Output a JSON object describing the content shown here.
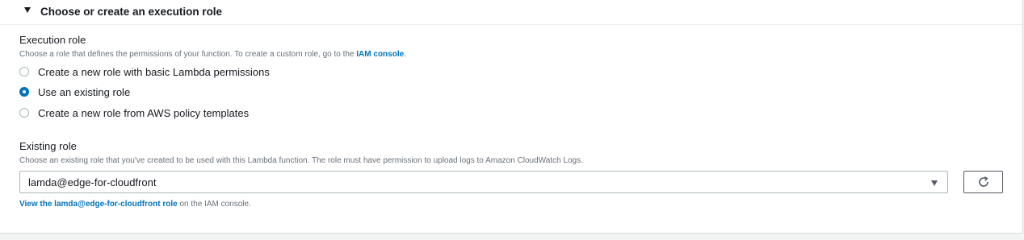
{
  "section": {
    "title": "Choose or create an execution role"
  },
  "execution_role": {
    "label": "Execution role",
    "description_prefix": "Choose a role that defines the permissions of your function. To create a custom role, go to the ",
    "description_link": "IAM console",
    "description_suffix": ".",
    "options": [
      {
        "label": "Create a new role with basic Lambda permissions",
        "selected": false
      },
      {
        "label": "Use an existing role",
        "selected": true
      },
      {
        "label": "Create a new role from AWS policy templates",
        "selected": false
      }
    ]
  },
  "existing_role": {
    "label": "Existing role",
    "description": "Choose an existing role that you've created to be used with this Lambda function. The role must have permission to upload logs to Amazon CloudWatch Logs.",
    "selected_value": "lamda@edge-for-cloudfront",
    "view_link": "View the lamda@edge-for-cloudfront role",
    "view_suffix": " on the IAM console."
  },
  "icons": {
    "caret": "caret-down-icon",
    "dropdown": "chevron-down-icon",
    "refresh": "refresh-icon"
  },
  "colors": {
    "link": "#0073bb",
    "radio_selected": "#0073bb",
    "border": "#aab7b8"
  }
}
